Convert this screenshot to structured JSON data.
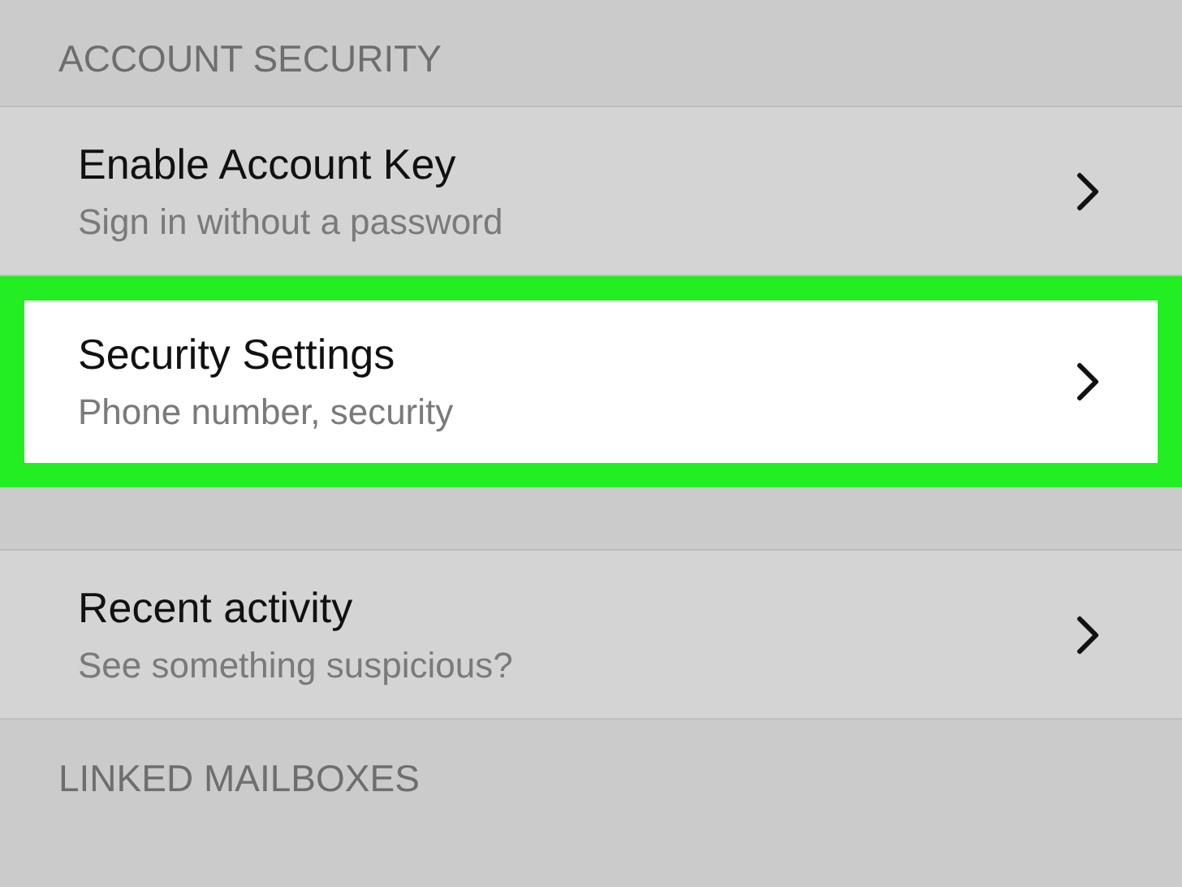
{
  "sections": [
    {
      "header": "ACCOUNT SECURITY",
      "items": [
        {
          "title": "Enable Account Key",
          "subtitle": "Sign in without a password",
          "highlighted": false
        },
        {
          "title": "Security Settings",
          "subtitle": "Phone number, security",
          "highlighted": true
        }
      ]
    },
    {
      "items": [
        {
          "title": "Recent activity",
          "subtitle": "See something suspicious?",
          "highlighted": false
        }
      ]
    },
    {
      "header": "LINKED MAILBOXES"
    }
  ]
}
